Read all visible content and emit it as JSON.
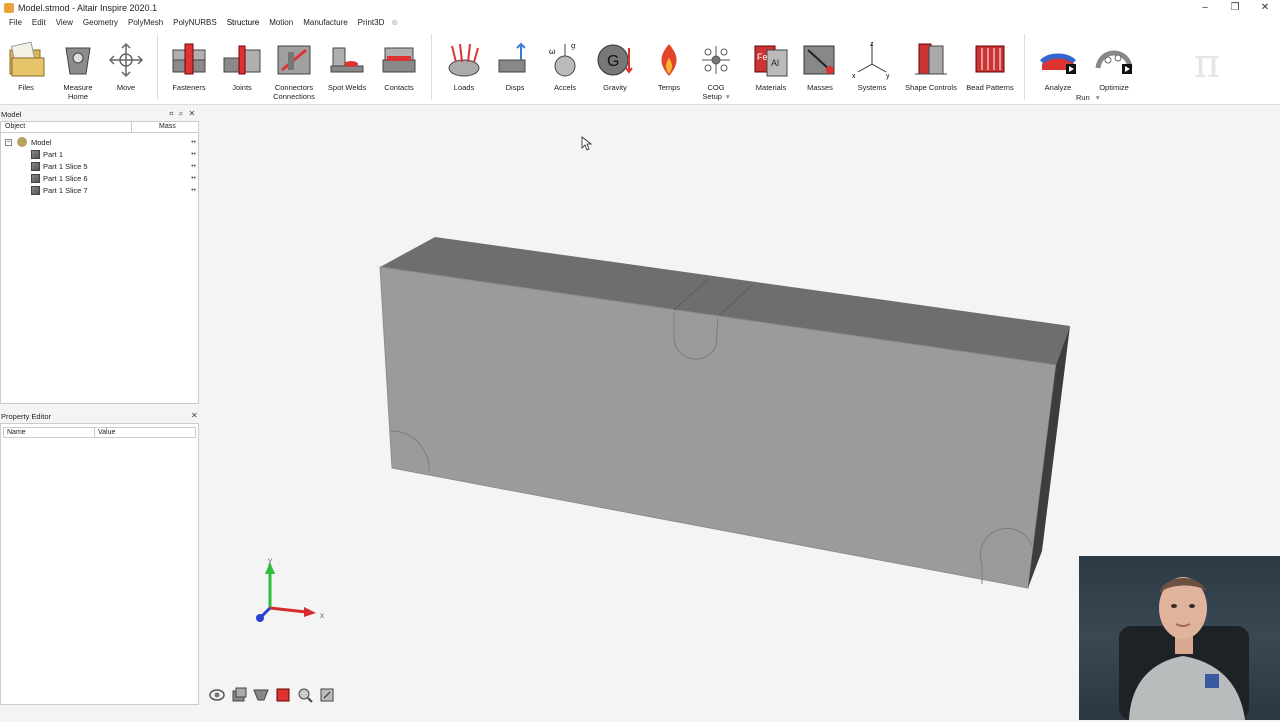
{
  "window": {
    "title": "Model.stmod - Altair Inspire 2020.1",
    "controls": [
      "–",
      "❐",
      "✕"
    ]
  },
  "menu": {
    "items": [
      "File",
      "Edit",
      "View",
      "Geometry",
      "PolyMesh",
      "PolyNURBS",
      "Structure",
      "Motion",
      "Manufacture",
      "Print3D"
    ],
    "active": "Structure"
  },
  "ribbon": {
    "files": "Files",
    "measure_home": [
      "Measure",
      "Home"
    ],
    "move": "Move",
    "fasteners": "Fasteners",
    "joints": "Joints",
    "connectors": [
      "Connectors",
      "Connections"
    ],
    "spot_welds": "Spot Welds",
    "contacts": "Contacts",
    "loads": "Loads",
    "disps": "Disps",
    "accels": "Accels",
    "gravity": "Gravity",
    "temps": "Temps",
    "cog": [
      "COG",
      "Setup"
    ],
    "materials": "Materials",
    "masses": "Masses",
    "systems": "Systems",
    "shape_controls": "Shape Controls",
    "bead_patterns": "Bead Patterns",
    "analyze": "Analyze",
    "optimize": "Optimize",
    "run": "Run",
    "setup_arrow": "▾",
    "run_arrow": "▾"
  },
  "model_panel": {
    "title": "Model",
    "col_object": "Object",
    "col_mass": "Mass",
    "root": "Model",
    "parts": [
      "Part 1",
      "Part 1 Slice 5",
      "Part 1 Slice 6",
      "Part 1 Slice 7"
    ],
    "dots": "••"
  },
  "property_editor": {
    "title": "Property Editor",
    "col_name": "Name",
    "col_value": "Value"
  },
  "axis": {
    "x": "x",
    "y": "y"
  },
  "logo": "π",
  "brand_colors": {
    "accent": "#1a73e8",
    "part_gray": "#999999",
    "top_gray": "#6b6b6b"
  }
}
